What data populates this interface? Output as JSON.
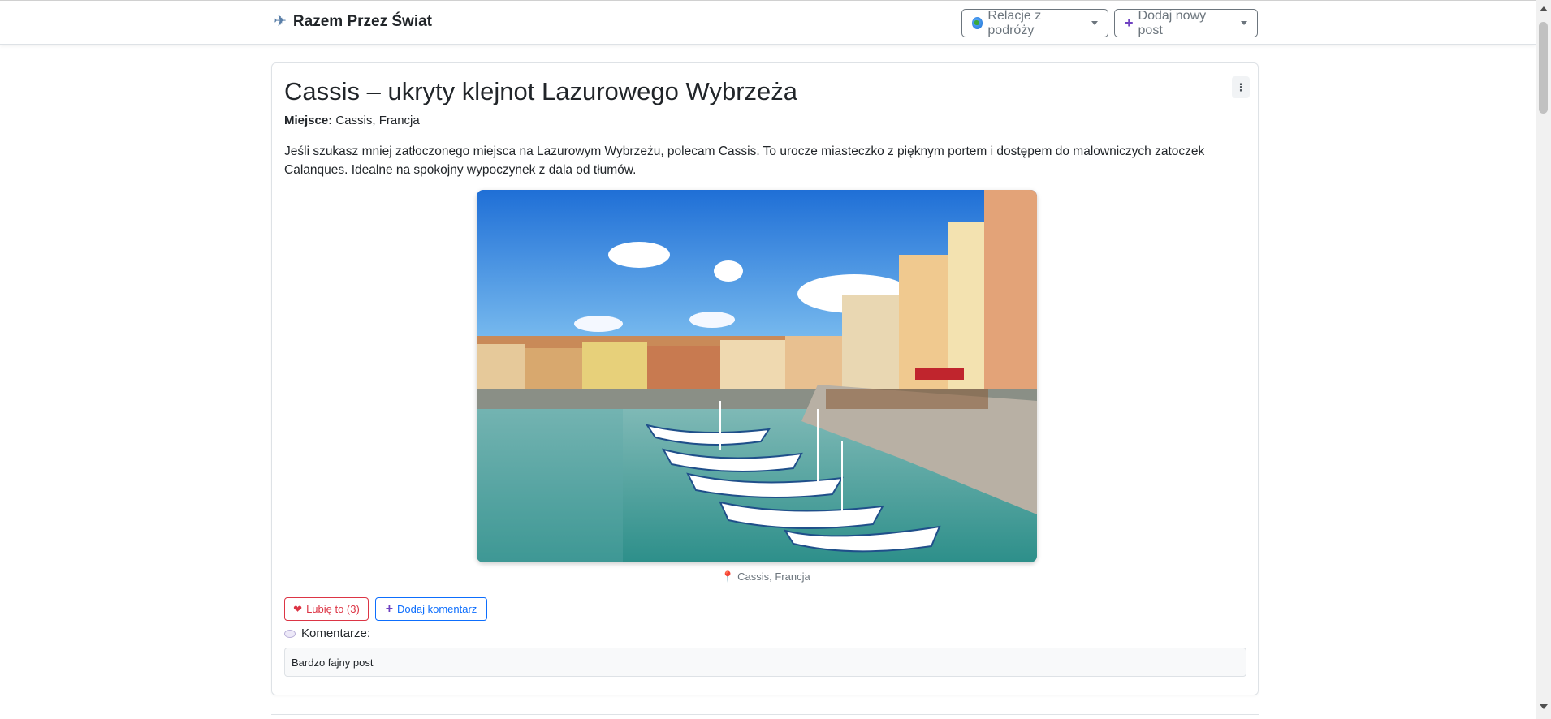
{
  "navbar": {
    "brand": "Razem Przez Świat",
    "brand_icon": "airplane-icon",
    "relacje_label": "Relacje z podróży",
    "dodaj_label": "Dodaj nowy post"
  },
  "post": {
    "title": "Cassis – ukryty klejnot Lazurowego Wybrzeża",
    "place_label": "Miejsce:",
    "place_value": "Cassis, Francja",
    "description": "Jeśli szukasz mniej zatłoczonego miejsca na Lazurowym Wybrzeżu, polecam Cassis. To urocze miasteczko z pięknym portem i dostępem do malowniczych zatoczek Calanques. Idealne na spokojny wypoczynek z dala od tłumów.",
    "image_caption": "Cassis, Francja",
    "like_label": "Lubię to (3)",
    "add_comment_label": "Dodaj komentarz",
    "comments_heading": "Komentarze:",
    "comments": [
      "Bardzo fajny post"
    ]
  },
  "colors": {
    "like": "#dc3545",
    "comment": "#0d6efd",
    "secondary": "#6c757d"
  }
}
